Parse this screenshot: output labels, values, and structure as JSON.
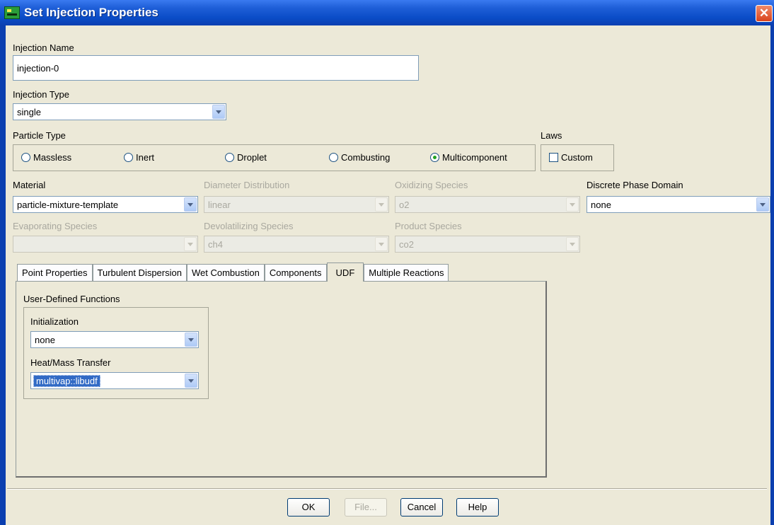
{
  "window": {
    "title": "Set Injection Properties",
    "close_glyph": "✕"
  },
  "injection_name": {
    "label": "Injection Name",
    "value": "injection-0"
  },
  "injection_type": {
    "label": "Injection Type",
    "value": "single"
  },
  "particle_type": {
    "label": "Particle Type",
    "options": [
      "Massless",
      "Inert",
      "Droplet",
      "Combusting",
      "Multicomponent"
    ],
    "selected": "Multicomponent"
  },
  "laws": {
    "label": "Laws",
    "custom_label": "Custom",
    "custom_checked": false
  },
  "material": {
    "label": "Material",
    "value": "particle-mixture-template"
  },
  "diameter_distribution": {
    "label": "Diameter Distribution",
    "value": "linear"
  },
  "oxidizing_species": {
    "label": "Oxidizing Species",
    "value": "o2"
  },
  "discrete_phase_domain": {
    "label": "Discrete Phase Domain",
    "value": "none"
  },
  "evaporating_species": {
    "label": "Evaporating Species",
    "value": ""
  },
  "devolatilizing_species": {
    "label": "Devolatilizing Species",
    "value": "ch4"
  },
  "product_species": {
    "label": "Product Species",
    "value": "co2"
  },
  "tabs": [
    "Point Properties",
    "Turbulent Dispersion",
    "Wet Combustion",
    "Components",
    "UDF",
    "Multiple Reactions"
  ],
  "active_tab": "UDF",
  "udf": {
    "group_label": "User-Defined Functions",
    "initialization_label": "Initialization",
    "initialization_value": "none",
    "heat_mass_label": "Heat/Mass Transfer",
    "heat_mass_value": "multivap::libudf"
  },
  "buttons": {
    "ok": "OK",
    "file": "File...",
    "cancel": "Cancel",
    "help": "Help"
  },
  "colors": {
    "titlebar": "#0a4cc7",
    "dialog_bg": "#ece9d8",
    "selection": "#316ac5",
    "radio_dot": "#21a121"
  }
}
